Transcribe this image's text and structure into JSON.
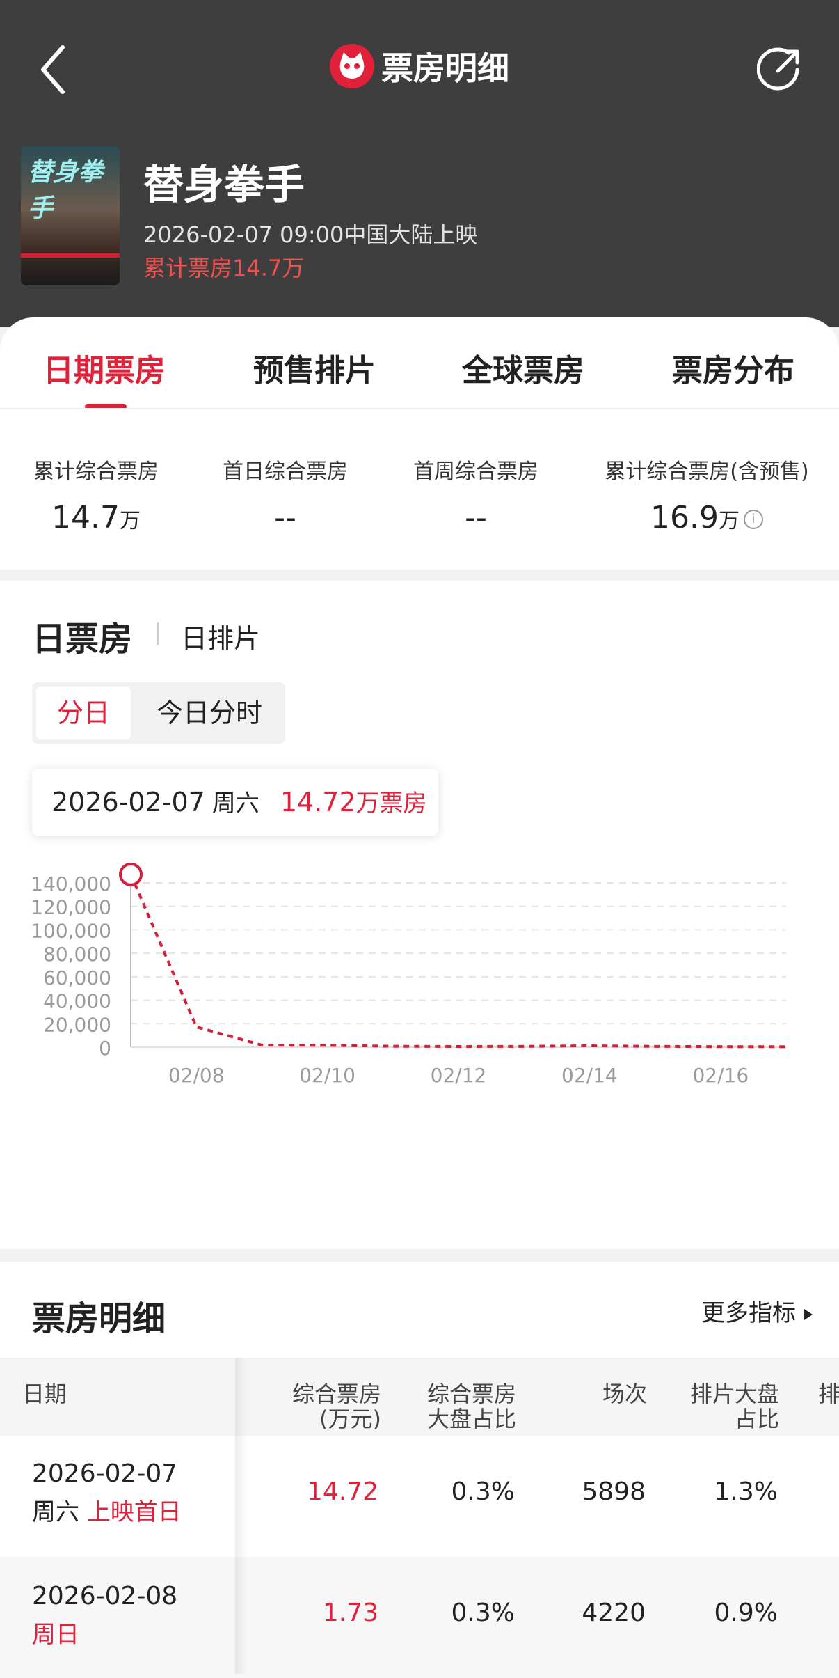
{
  "nav": {
    "title": "票房明细"
  },
  "movie": {
    "title": "替身拳手",
    "poster_text": "替身拳手",
    "release": "2026-02-07 09:00中国大陆上映",
    "cumulative": "累计票房14.7万"
  },
  "tabs": [
    "日期票房",
    "预售排片",
    "全球票房",
    "票房分布"
  ],
  "stats": [
    {
      "label": "累计综合票房",
      "value": "14.7",
      "unit": "万"
    },
    {
      "label": "首日综合票房",
      "value": "--",
      "unit": ""
    },
    {
      "label": "首周综合票房",
      "value": "--",
      "unit": ""
    },
    {
      "label": "累计综合票房(含预售)",
      "value": "16.9",
      "unit": "万"
    }
  ],
  "daily": {
    "title": "日票房",
    "subtitle": "日排片",
    "segments": [
      "分日",
      "今日分时"
    ],
    "tooltip": {
      "date": "2026-02-07",
      "weekday": "周六",
      "value": "14.72",
      "unit": "万票房"
    }
  },
  "chart_data": {
    "type": "line",
    "x": [
      "02/07",
      "02/08",
      "02/09",
      "02/10",
      "02/11",
      "02/12",
      "02/13",
      "02/14",
      "02/15",
      "02/16",
      "02/17"
    ],
    "series": [
      {
        "values": [
          147200,
          17300,
          1800,
          1600,
          800,
          600,
          700,
          1200,
          700,
          500,
          400
        ]
      }
    ],
    "xticks": [
      "02/08",
      "02/10",
      "02/12",
      "02/14",
      "02/16"
    ],
    "yticks": [
      "0",
      "20,000",
      "40,000",
      "60,000",
      "80,000",
      "100,000",
      "120,000",
      "140,000"
    ],
    "ylim": [
      0,
      140000
    ],
    "grid": true,
    "highlight_index": 0,
    "color": "#d41e3a"
  },
  "detail": {
    "title": "票房明细",
    "more": "更多指标",
    "headers": {
      "date": "日期",
      "box": [
        "综合票房",
        "(万元)"
      ],
      "share": [
        "综合票房",
        "大盘占比"
      ],
      "shows": "场次",
      "show_share": [
        "排片大盘",
        "占比"
      ],
      "extra": "排"
    },
    "rows": [
      {
        "date": "2026-02-07",
        "weekday": "周六",
        "tag": "上映首日",
        "box": "14.72",
        "share": "0.3%",
        "shows": "5898",
        "show_share": "1.3%"
      },
      {
        "date": "2026-02-08",
        "weekday": "周日",
        "tag": "",
        "box": "1.73",
        "share": "0.3%",
        "shows": "4220",
        "show_share": "0.9%"
      }
    ]
  }
}
